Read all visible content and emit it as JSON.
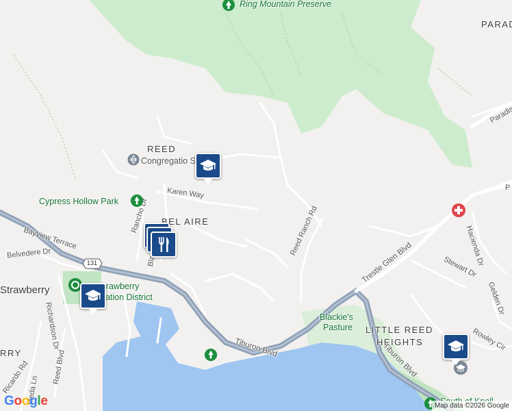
{
  "map": {
    "areas": [
      {
        "name": "REED"
      },
      {
        "name": "BEL AIRE"
      },
      {
        "name": "Strawberry"
      },
      {
        "name": "LITTLE REED"
      },
      {
        "name": "HEIGHTS"
      },
      {
        "name": "PARAD"
      },
      {
        "name": "RRY"
      }
    ],
    "streets": [
      {
        "name": "Karen Way"
      },
      {
        "name": "Rancho Dr"
      },
      {
        "name": "Bayview Terrace"
      },
      {
        "name": "Belvedere Dr"
      },
      {
        "name": "Richardson Dr"
      },
      {
        "name": "Reed Blvd"
      },
      {
        "name": "Ricardo Rd"
      },
      {
        "name": "Meda Ln"
      },
      {
        "name": "Tiburon Blvd"
      },
      {
        "name": "Tiburon Blvd"
      },
      {
        "name": "Reed Ranch Rd"
      },
      {
        "name": "Trestle Glen Blvd"
      },
      {
        "name": "Stewart Dr"
      },
      {
        "name": "Hacienda Dr"
      },
      {
        "name": "Gelden Dr"
      },
      {
        "name": "Rowley Cir"
      },
      {
        "name": "Paradise"
      },
      {
        "name": "P"
      },
      {
        "name": "Bla"
      }
    ],
    "route_shield": "131",
    "pois": [
      {
        "name": "Ring Mountain Preserve"
      },
      {
        "name": "Cypress Hollow Park"
      },
      {
        "name": "Congregation Kol Shofar",
        "display": "Congregatio  Shofar"
      },
      {
        "name": "Strawberry Recreation District",
        "display": "Strawberry"
      },
      {
        "name": "Strawberry Recreation District line2",
        "display": "eation District"
      },
      {
        "name": "Blackie's"
      },
      {
        "name": "Pasture"
      },
      {
        "name": "South of Knoll",
        "display": "South of Knoll"
      }
    ],
    "colors": {
      "park": "#cdeccd",
      "highway": "#8e9fb5",
      "water": "#9fc5f1",
      "marker": "#1a4a8a",
      "park_text": "#137333"
    }
  },
  "attribution": "Map data ©2026 Google",
  "logo": "Google"
}
